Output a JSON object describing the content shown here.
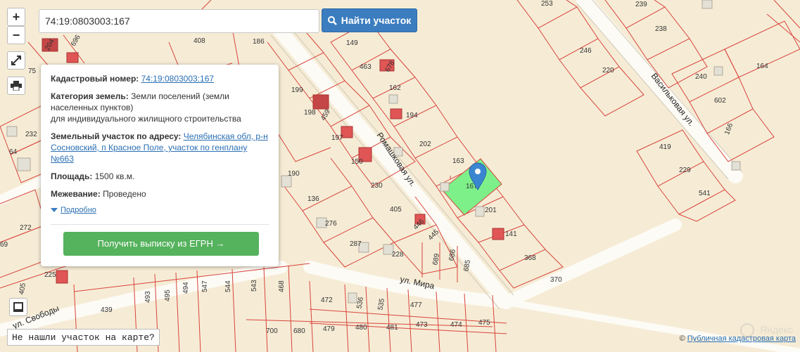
{
  "search": {
    "value": "74:19:0803003:167",
    "button_label": "Найти участок"
  },
  "zoom": {
    "plus": "+",
    "minus": "−"
  },
  "popup": {
    "cadastral_label": "Кадастровый номер:",
    "cadastral_value": "74:19:0803003:167",
    "category_label": "Категория земель:",
    "category_value": "Земли поселений (земли населенных пунктов)",
    "category_usage": "для индивидуального жилищного строительства",
    "address_label": "Земельный участок по адресу:",
    "address_value": "Челябинская обл, р-н Сосновский, п Красное Поле, участок по генплану №663",
    "area_label": "Площадь:",
    "area_value": "1500 кв.м.",
    "survey_label": "Межевание:",
    "survey_value": "Проведено",
    "more_label": "Подробно",
    "egrn_button": "Получить выписку из ЕГРН →"
  },
  "not_found": "Не нашли участок на карте?",
  "copyright": {
    "symbol": "©",
    "link": "Публичная кадастровая карта"
  },
  "streets": [
    "Ромашковая ул.",
    "Васильковая ул.",
    "ул. Мира",
    "ул. Свободы"
  ],
  "plot_numbers": [
    "253",
    "239",
    "238",
    "246",
    "220",
    "240",
    "164",
    "602",
    "166",
    "419",
    "229",
    "541",
    "149",
    "463",
    "678",
    "162",
    "194",
    "202",
    "163",
    "167",
    "201",
    "141",
    "368",
    "370",
    "408",
    "186",
    "199",
    "198",
    "459",
    "197",
    "150",
    "190",
    "230",
    "136",
    "405",
    "276",
    "446",
    "445",
    "287",
    "228",
    "689",
    "686",
    "685",
    "204",
    "696",
    "75",
    "232",
    "64",
    "272",
    "69",
    "225",
    "405",
    "439",
    "493",
    "495",
    "494",
    "547",
    "544",
    "543",
    "468",
    "472",
    "536",
    "535",
    "477",
    "700",
    "680",
    "479",
    "480",
    "481",
    "473",
    "474",
    "475"
  ],
  "colors": {
    "map_bg": "#f6ecd6",
    "parcel_line": "#d9443c",
    "selected_parcel": "#7ef08a",
    "building": "#e3e0d6",
    "road": "#ffffff",
    "marker": "#3b86d0",
    "button_blue": "#3b7dbf",
    "button_green": "#55b25d"
  },
  "icons": [
    "fullscreen-icon",
    "print-icon",
    "layers-icon",
    "search-icon",
    "location-marker-icon"
  ]
}
